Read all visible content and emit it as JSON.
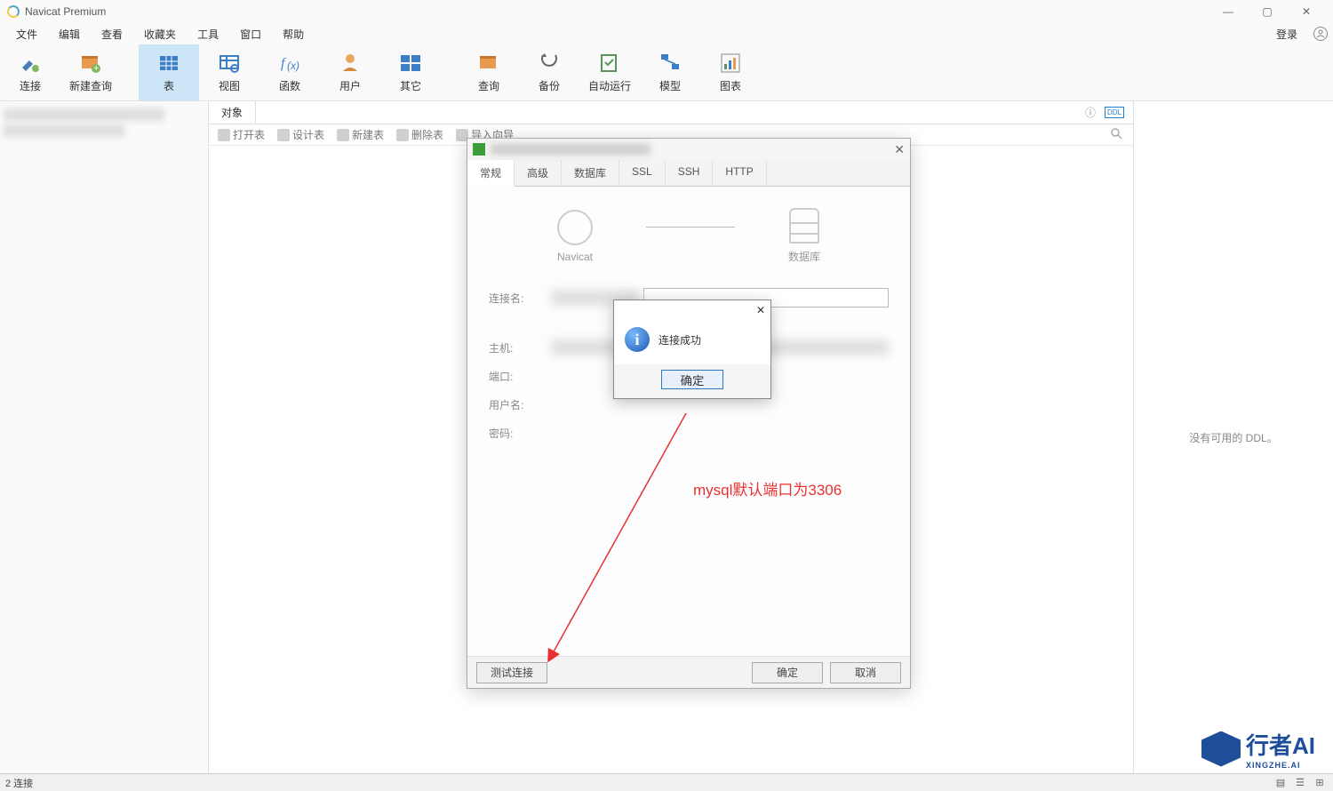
{
  "app": {
    "title": "Navicat Premium"
  },
  "window_controls": {
    "min": "—",
    "max": "▢",
    "close": "✕"
  },
  "menu": {
    "file": "文件",
    "edit": "编辑",
    "view": "查看",
    "fav": "收藏夹",
    "tools": "工具",
    "window": "窗口",
    "help": "帮助",
    "login": "登录"
  },
  "toolbar": {
    "connect": "连接",
    "newquery": "新建查询",
    "table": "表",
    "view": "视图",
    "function": "函数",
    "user": "用户",
    "other": "其它",
    "query": "查询",
    "backup": "备份",
    "autorun": "自动运行",
    "model": "模型",
    "chart": "图表"
  },
  "tabs": {
    "objects": "对象"
  },
  "subtoolbar": {
    "open": "打开表",
    "design": "设计表",
    "new": "新建表",
    "delete": "删除表",
    "import": "导入向导"
  },
  "rightpane": {
    "noddl": "没有可用的 DDL。"
  },
  "status": {
    "connections": "2 连接"
  },
  "conn_dialog": {
    "tabs": {
      "general": "常规",
      "advanced": "高级",
      "database": "数据库",
      "ssl": "SSL",
      "ssh": "SSH",
      "http": "HTTP"
    },
    "icons": {
      "navicat": "Navicat",
      "database": "数据库"
    },
    "fields": {
      "name": "连接名:",
      "host": "主机:",
      "port": "端口:",
      "user": "用户名:",
      "password": "密码:"
    },
    "buttons": {
      "test": "测试连接",
      "ok": "确定",
      "cancel": "取消"
    }
  },
  "msgbox": {
    "text": "连接成功",
    "ok": "确定",
    "close": "✕"
  },
  "annotation": {
    "text": "mysql默认端口为3306"
  },
  "watermark": {
    "brand": "行者AI",
    "sub": "XINGZHE.AI"
  },
  "right_icons": {
    "info": "ⓘ",
    "ddl": "DDL"
  }
}
